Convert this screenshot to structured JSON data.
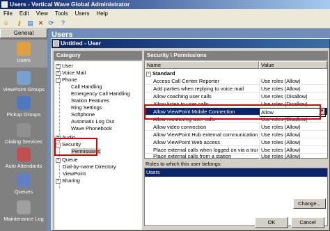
{
  "window": {
    "title": "Users - Vertical Wave Global Administrator"
  },
  "menu": [
    "File",
    "Edit",
    "View",
    "Tools",
    "Users",
    "Help"
  ],
  "nav": {
    "header": "General",
    "items": [
      {
        "label": "Users"
      },
      {
        "label": "ViewPoint Groups"
      },
      {
        "label": "Pickup Groups"
      },
      {
        "label": "Dialing Services"
      },
      {
        "label": "Auto Attendants"
      },
      {
        "label": "Queues"
      },
      {
        "label": "Maintenance Log"
      }
    ]
  },
  "users_panel": {
    "heading": "Users"
  },
  "dialog": {
    "title": "Untitled - User",
    "category_header": "Category",
    "section_header": "Security \\ Permissions",
    "tree": [
      {
        "label": "User",
        "toggle": "+"
      },
      {
        "label": "Voice Mail",
        "toggle": "+"
      },
      {
        "label": "Phone",
        "toggle": "-"
      },
      {
        "label": "Call Handling"
      },
      {
        "label": "Emergency Call Handling"
      },
      {
        "label": "Station Features"
      },
      {
        "label": "Ring Settings"
      },
      {
        "label": "Softphone"
      },
      {
        "label": "Automatic Log Out"
      },
      {
        "label": "Wave Phonebook"
      },
      {
        "label": "Audio",
        "toggle": "+"
      },
      {
        "label": "Security",
        "toggle": "-"
      },
      {
        "label": "Permissions"
      },
      {
        "label": "Queue",
        "toggle": "+"
      },
      {
        "label": "Dial-by-name Directory"
      },
      {
        "label": "ViewPoint"
      },
      {
        "label": "Sharing",
        "toggle": "+"
      }
    ],
    "grid": {
      "col_name": "Name",
      "col_value": "Value",
      "group": "Standard",
      "rows": [
        {
          "name": "Access Call Center Reporter",
          "value": "Use roles (Allow)"
        },
        {
          "name": "Add parties when replying to voice mail",
          "value": "Use roles (Allow)"
        },
        {
          "name": "Allow coaching user calls",
          "value": "Use roles (Disallow)"
        },
        {
          "name": "Allow listen to user calls",
          "value": "Use roles (Disallow)"
        },
        {
          "name": "Allow ViewPoint Mobile Connection",
          "value": "Allow",
          "selected": true
        },
        {
          "name": "Allow monitoring user calls",
          "value": "Use roles (Disallow)"
        },
        {
          "name": "Allow video connection",
          "value": "Use roles (Allow)"
        },
        {
          "name": "Allow ViewPoint Hub external communication",
          "value": "Use roles (Allow)"
        },
        {
          "name": "Allow ViewPoint Web access",
          "value": "Use roles (Allow)"
        },
        {
          "name": "Place external calls when logged on via a trunk",
          "value": "Use roles (Allow)"
        },
        {
          "name": "Place external calls from a station",
          "value": "Use roles (Allow)"
        }
      ]
    },
    "roles_label": "Roles to which this user belongs:",
    "roles": [
      "Users"
    ],
    "change_button": "Change...",
    "ok_button": "OK",
    "cancel_button": "Cancel",
    "highlight_color": "#e00000"
  }
}
